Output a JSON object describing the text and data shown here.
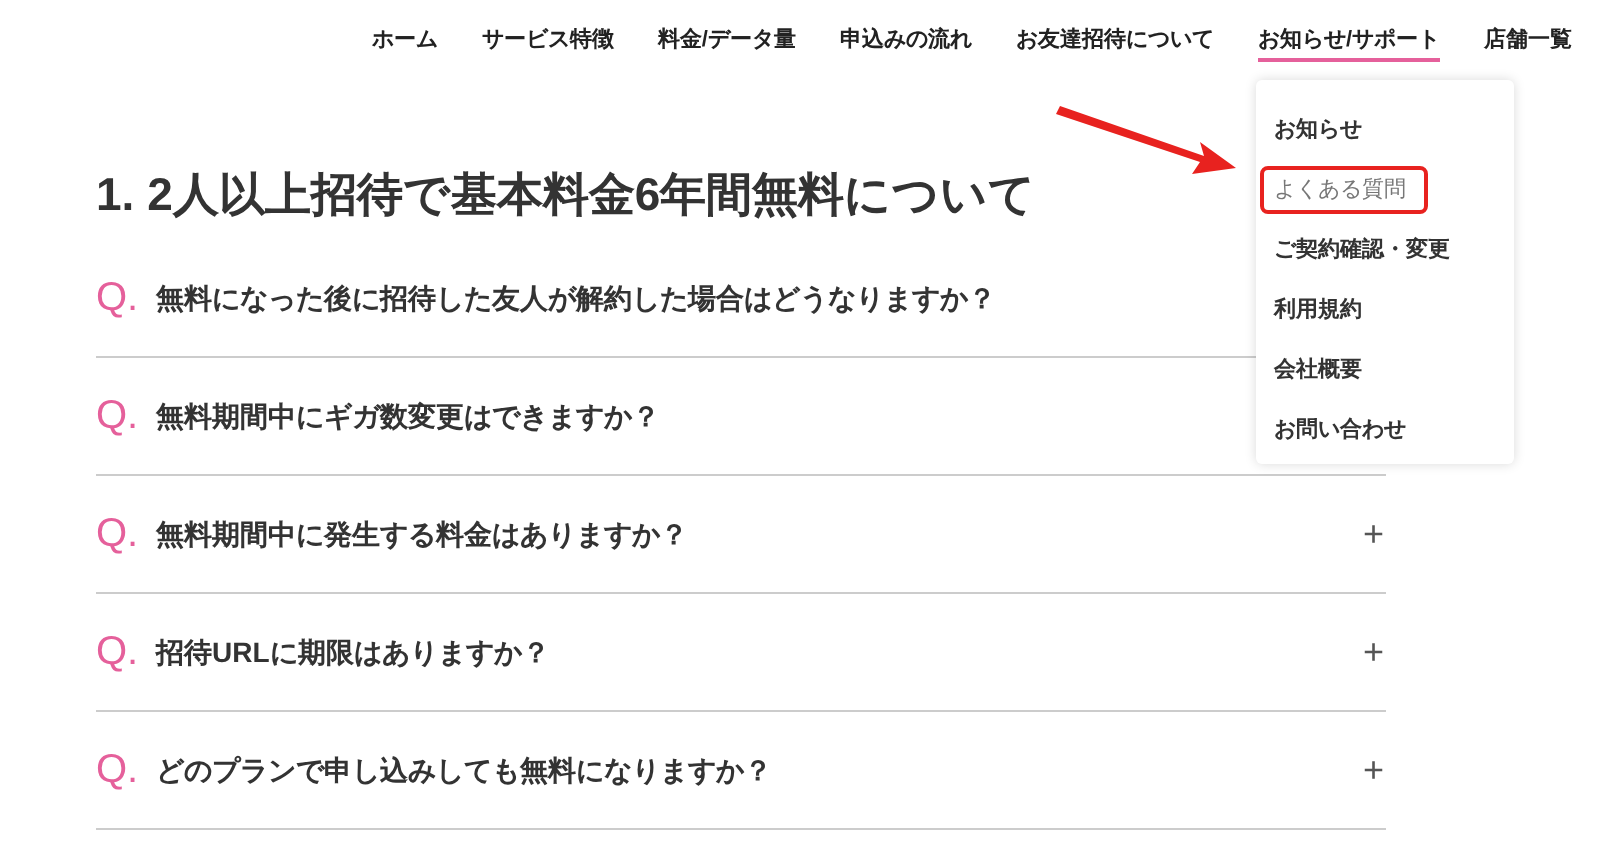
{
  "nav": [
    {
      "label": "ホーム",
      "selected": false
    },
    {
      "label": "サービス特徴",
      "selected": false
    },
    {
      "label": "料金/データ量",
      "selected": false
    },
    {
      "label": "申込みの流れ",
      "selected": false
    },
    {
      "label": "お友達招待について",
      "selected": false
    },
    {
      "label": "お知らせ/サポート",
      "selected": true
    },
    {
      "label": "店舗一覧",
      "selected": false
    }
  ],
  "dropdown": [
    {
      "label": "お知らせ",
      "highlighted": false
    },
    {
      "label": "よくある質問",
      "highlighted": true
    },
    {
      "label": "ご契約確認・変更",
      "highlighted": false
    },
    {
      "label": "利用規約",
      "highlighted": false
    },
    {
      "label": "会社概要",
      "highlighted": false
    },
    {
      "label": "お問い合わせ",
      "highlighted": false
    }
  ],
  "heading": "1. 2人以上招待で基本料金6年間無料について",
  "faq": [
    {
      "q": "Q.",
      "text": "無料になった後に招待した友人が解約した場合はどうなりますか？"
    },
    {
      "q": "Q.",
      "text": "無料期間中にギガ数変更はできますか？"
    },
    {
      "q": "Q.",
      "text": "無料期間中に発生する料金はありますか？",
      "toggle": "+"
    },
    {
      "q": "Q.",
      "text": "招待URLに期限はありますか？",
      "toggle": "+"
    },
    {
      "q": "Q.",
      "text": "どのプランで申し込みしても無料になりますか？",
      "toggle": "+"
    }
  ]
}
